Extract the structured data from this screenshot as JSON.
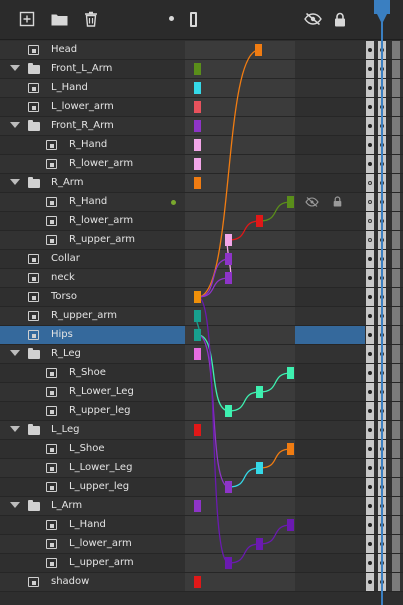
{
  "toolbar": {
    "icons": [
      "add-icon",
      "folder-icon",
      "trash-icon",
      "dot-indicator-icon",
      "frame-icon",
      "visibility-off-icon",
      "lock-icon"
    ]
  },
  "colors": {
    "panel": "#323232",
    "selected": "#35699c",
    "playhead": "#3a7fc1",
    "graph_bg": "#3b3b3b"
  },
  "layers": [
    {
      "label": "Head",
      "type": "bone",
      "depth": 1,
      "key_color": "#f07c12"
    },
    {
      "label": "Front_L_Arm",
      "type": "group",
      "depth": 0,
      "key_color": "#5a8e1a"
    },
    {
      "label": "L_Hand",
      "type": "bone",
      "depth": 1,
      "key_color": "#35d9e8"
    },
    {
      "label": "L_lower_arm",
      "type": "bone",
      "depth": 1,
      "key_color": "#e8525c"
    },
    {
      "label": "Front_R_Arm",
      "type": "group",
      "depth": 0,
      "key_color": "#8e34c8"
    },
    {
      "label": "R_Hand",
      "type": "bone",
      "depth": 2,
      "key_color": "#f2a6e8"
    },
    {
      "label": "R_lower_arm",
      "type": "bone",
      "depth": 2,
      "key_color": "#f2a6e8"
    },
    {
      "label": "R_Arm",
      "type": "group",
      "depth": 0,
      "key_color": "#f07c12"
    },
    {
      "label": "R_Hand",
      "type": "bone",
      "depth": 2,
      "key_color": "#5a8e1a"
    },
    {
      "label": "R_lower_arm",
      "type": "bone",
      "depth": 2,
      "key_color": "#e01818"
    },
    {
      "label": "R_upper_arm",
      "type": "bone",
      "depth": 2,
      "key_color": "#f2a6e8"
    },
    {
      "label": "Collar",
      "type": "bone",
      "depth": 1,
      "key_color": "#8e34c8"
    },
    {
      "label": "neck",
      "type": "bone",
      "depth": 1,
      "key_color": "#8e34c8"
    },
    {
      "label": "Torso",
      "type": "bone",
      "depth": 1,
      "key_color": "#f0900a"
    },
    {
      "label": "R_upper_arm",
      "type": "bone",
      "depth": 1,
      "key_color": "#17a08e"
    },
    {
      "label": "Hips",
      "type": "bone",
      "depth": 1,
      "key_color": "#17a08e"
    },
    {
      "label": "R_Leg",
      "type": "group",
      "depth": 0,
      "key_color": "#e66de0"
    },
    {
      "label": "R_Shoe",
      "type": "bone",
      "depth": 2,
      "key_color": "#3ef0b0"
    },
    {
      "label": "R_Lower_Leg",
      "type": "bone",
      "depth": 2,
      "key_color": "#3ef0b0"
    },
    {
      "label": "R_upper_leg",
      "type": "bone",
      "depth": 2,
      "key_color": "#3ef0b0"
    },
    {
      "label": "L_Leg",
      "type": "group",
      "depth": 0,
      "key_color": "#e01818"
    },
    {
      "label": "L_Shoe",
      "type": "bone",
      "depth": 2,
      "key_color": "#f07c12"
    },
    {
      "label": "L_Lower_Leg",
      "type": "bone",
      "depth": 2,
      "key_color": "#35d9e8"
    },
    {
      "label": "L_upper_leg",
      "type": "bone",
      "depth": 2,
      "key_color": "#8e34c8"
    },
    {
      "label": "L_Arm",
      "type": "group",
      "depth": 0,
      "key_color": "#8e34c8"
    },
    {
      "label": "L_Hand",
      "type": "bone",
      "depth": 2,
      "key_color": "#6a1ab0"
    },
    {
      "label": "L_lower_arm",
      "type": "bone",
      "depth": 2,
      "key_color": "#6a1ab0"
    },
    {
      "label": "L_upper_arm",
      "type": "bone",
      "depth": 2,
      "key_color": "#6a1ab0"
    },
    {
      "label": "shadow",
      "type": "bone",
      "depth": 1,
      "key_color": "#e01818"
    }
  ],
  "selected_index": 15,
  "visibility_row_index": 8
}
